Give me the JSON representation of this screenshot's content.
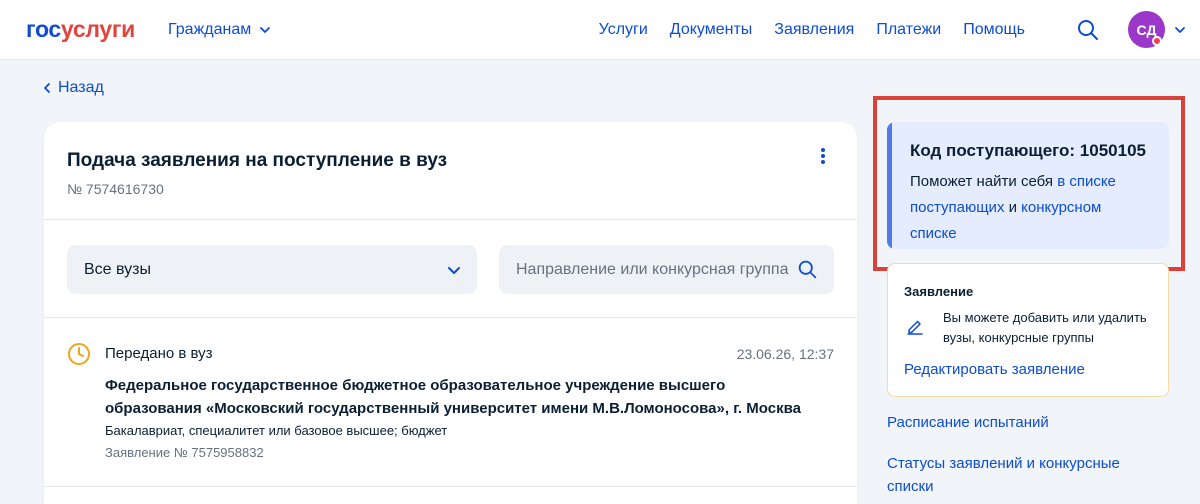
{
  "header": {
    "logo_part1": "гос",
    "logo_part2": "услуги",
    "audience": "Гражданам",
    "nav": [
      "Услуги",
      "Документы",
      "Заявления",
      "Платежи",
      "Помощь"
    ],
    "avatar_initials": "СД"
  },
  "back_label": "Назад",
  "application": {
    "title": "Подача заявления на поступление в вуз",
    "number": "№ 7574616730",
    "filter_select": "Все вузы",
    "search_placeholder": "Направление или конкурсная группа",
    "entry": {
      "status": "Передано в вуз",
      "datetime": "23.06.26, 12:37",
      "university": "Федеральное государственное бюджетное образовательное учреждение высшего образования «Московский государственный университет имени М.В.Ломоносова», г. Москва",
      "level": "Бакалавриат, специалитет или базовое высшее; бюджет",
      "app_number": "Заявление № 7575958832"
    }
  },
  "applicant_code": {
    "title": "Код поступающего: 1050105",
    "text_before": "Поможет найти себя ",
    "link1": "в списке поступающих",
    "text_middle": " и ",
    "link2": "конкурсном списке"
  },
  "application_card": {
    "title": "Заявление",
    "description": "Вы можете добавить или удалить вузы, конкурсные группы",
    "edit_link": "Редактировать заявление"
  },
  "links": {
    "schedule": "Расписание испытаний",
    "statuses": "Статусы заявлений и конкурсные списки"
  },
  "colors": {
    "brand_blue": "#0d4cd3",
    "brand_red": "#e2443d",
    "status_clock": "#f0a41e",
    "highlight_frame": "#d9413a",
    "avatar_bg": "#9b38c9"
  },
  "icons": {
    "citizens": "chevron-down-icon",
    "search": "search-icon",
    "avatar_menu": "chevron-down-icon",
    "back": "chevron-left-icon",
    "menu": "kebab-menu-icon",
    "select": "chevron-down-icon",
    "status": "clock-icon",
    "edit": "pencil-icon"
  }
}
